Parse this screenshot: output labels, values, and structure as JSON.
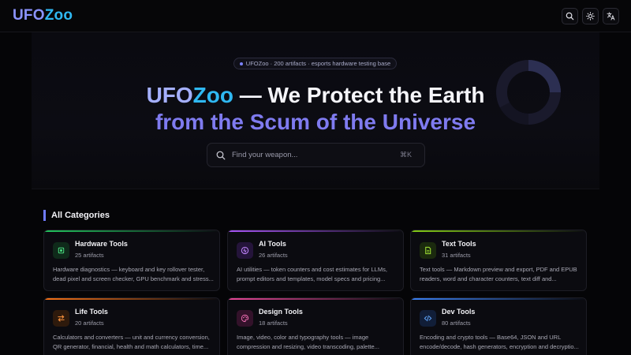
{
  "header": {
    "logo_ufo": "UFO",
    "logo_zoo": "Zoo",
    "buttons": [
      "search-icon",
      "sun-icon",
      "translate-icon"
    ]
  },
  "hero": {
    "badge": "UFOZoo · 200 artifacts · esports hardware testing base",
    "title_ufo": "UFO",
    "title_zoo": "Zoo",
    "title_rest": " — We Protect the Earth",
    "subtitle": "from the Scum of the Universe",
    "search_placeholder": "Find your weapon...",
    "search_shortcut": "⌘K"
  },
  "categories": {
    "heading": "All Categories",
    "items": [
      {
        "title": "Hardware Tools",
        "count": "25 artifacts",
        "desc": "Hardware diagnostics — keyboard and key rollover tester, dead pixel and screen checker, GPU benchmark and stress...",
        "icon": "chip-icon",
        "accent": "#22c55e"
      },
      {
        "title": "AI Tools",
        "count": "26 artifacts",
        "desc": "AI utilities — token counters and cost estimates for LLMs, prompt editors and templates, model specs and pricing...",
        "icon": "ai-icon",
        "accent": "#a855f7"
      },
      {
        "title": "Text Tools",
        "count": "31 artifacts",
        "desc": "Text tools — Markdown preview and export, PDF and EPUB readers, word and character counters, text diff and...",
        "icon": "document-icon",
        "accent": "#84cc16"
      },
      {
        "title": "Life Tools",
        "count": "20 artifacts",
        "desc": "Calculators and converters — unit and currency conversion, QR generator, financial, health and math calculators, time...",
        "icon": "swap-icon",
        "accent": "#f97316"
      },
      {
        "title": "Design Tools",
        "count": "18 artifacts",
        "desc": "Image, video, color and typography tools — image compression and resizing, video transcoding, palette...",
        "icon": "palette-icon",
        "accent": "#ec4899"
      },
      {
        "title": "Dev Tools",
        "count": "80 artifacts",
        "desc": "Encoding and crypto tools — Base64, JSON and URL encode/decode, hash generators, encryption and decryptio...",
        "icon": "code-icon",
        "accent": "#3b82f6"
      }
    ]
  }
}
